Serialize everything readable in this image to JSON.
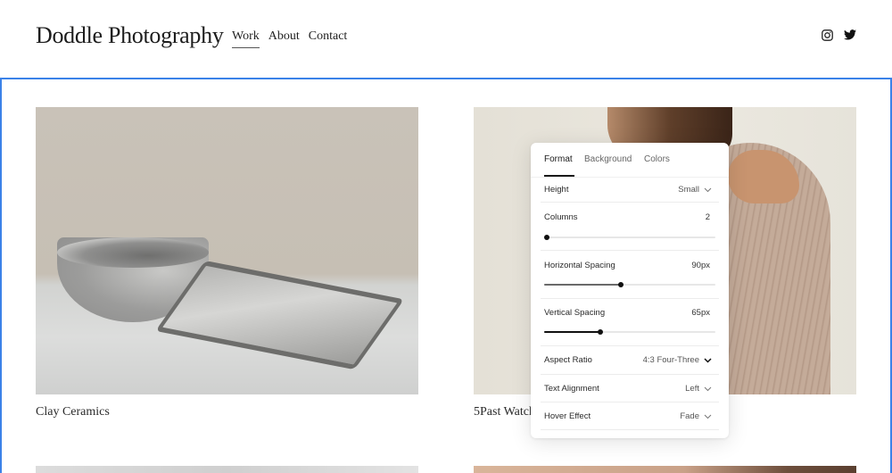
{
  "site": {
    "title": "Doddle Photography",
    "nav": [
      {
        "label": "Work",
        "active": true
      },
      {
        "label": "About",
        "active": false
      },
      {
        "label": "Contact",
        "active": false
      }
    ],
    "social_icons": [
      "instagram-icon",
      "twitter-icon"
    ]
  },
  "editor": {
    "section_outline_color": "#3b82e8"
  },
  "gallery": {
    "items": [
      {
        "caption": "Clay Ceramics"
      },
      {
        "caption": "5Past Watch"
      }
    ]
  },
  "panel": {
    "tabs": [
      {
        "label": "Format",
        "active": true
      },
      {
        "label": "Background",
        "active": false
      },
      {
        "label": "Colors",
        "active": false
      }
    ],
    "height": {
      "label": "Height",
      "value": "Small"
    },
    "columns": {
      "label": "Columns",
      "value": "2",
      "slider_fraction": 0.0
    },
    "horizontal_spacing": {
      "label": "Horizontal Spacing",
      "value": "90px",
      "slider_fraction": 0.45
    },
    "vertical_spacing": {
      "label": "Vertical Spacing",
      "value": "65px",
      "slider_fraction": 0.33
    },
    "aspect_ratio": {
      "label": "Aspect Ratio",
      "value": "4:3 Four-Three"
    },
    "text_alignment": {
      "label": "Text Alignment",
      "value": "Left"
    },
    "hover_effect": {
      "label": "Hover Effect",
      "value": "Fade"
    }
  }
}
